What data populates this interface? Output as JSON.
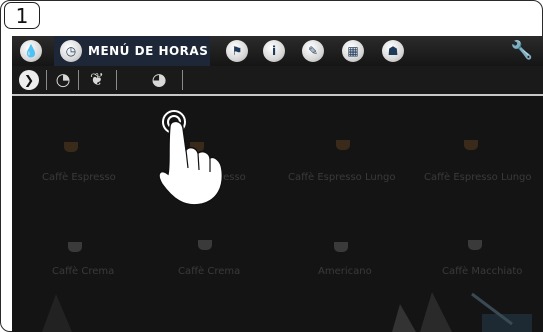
{
  "step": "1",
  "menu": {
    "active_tab": "MENÚ DE HORAS",
    "icons": [
      "water-drop-icon",
      "clock-icon",
      "flag-icon",
      "info-icon",
      "pencil-icon",
      "calendar-icon",
      "person-icon",
      "wrench-icon"
    ]
  },
  "subbar": {
    "icons": [
      "play-icon",
      "timer-icon",
      "leaf-icon",
      "drop-timer-icon"
    ]
  },
  "products": [
    {
      "label": "Caffè Espresso"
    },
    {
      "label": "Caffè Espresso"
    },
    {
      "label": "Caffè Espresso Lungo"
    },
    {
      "label": "Caffè Espresso Lungo"
    },
    {
      "label": "Caffè Crema"
    },
    {
      "label": "Caffè Crema"
    },
    {
      "label": "Americano"
    },
    {
      "label": "Caffè Macchiato"
    }
  ],
  "colors": {
    "background": "#141414",
    "active_tab": "#1d2738",
    "accent": "#3b5aa0"
  }
}
